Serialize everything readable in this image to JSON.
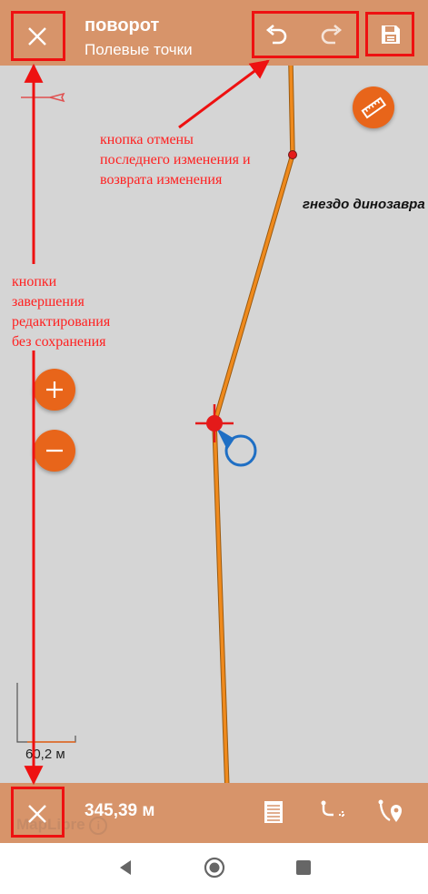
{
  "header": {
    "title": "поворот",
    "subtitle": "Полевые точки"
  },
  "toolbar": {
    "close_icon": "close-icon",
    "undo_icon": "undo-icon",
    "redo_icon": "redo-icon",
    "save_icon": "save-icon"
  },
  "map": {
    "place_label": "гнездо динозавра",
    "scale_label": "60,2 м",
    "attribution": "MapLibre",
    "line_color": "#ef8a1d",
    "point_color": "#e41a1a"
  },
  "bottom_bar": {
    "distance": "345,39 м",
    "icons": [
      "close-icon",
      "list-icon",
      "add-point-icon",
      "route-point-icon"
    ]
  },
  "annotations": {
    "undo_redo_note": "кнопка отмены\nпоследнего изменения и\nвозврата изменения",
    "exit_note": "кнопки\nзавершения\nредактирования\nбез сохранения"
  },
  "colors": {
    "bar": "#d7946a",
    "fab": "#e8651a",
    "annotation": "#ee1111",
    "map_background": "#d5d5d5"
  }
}
